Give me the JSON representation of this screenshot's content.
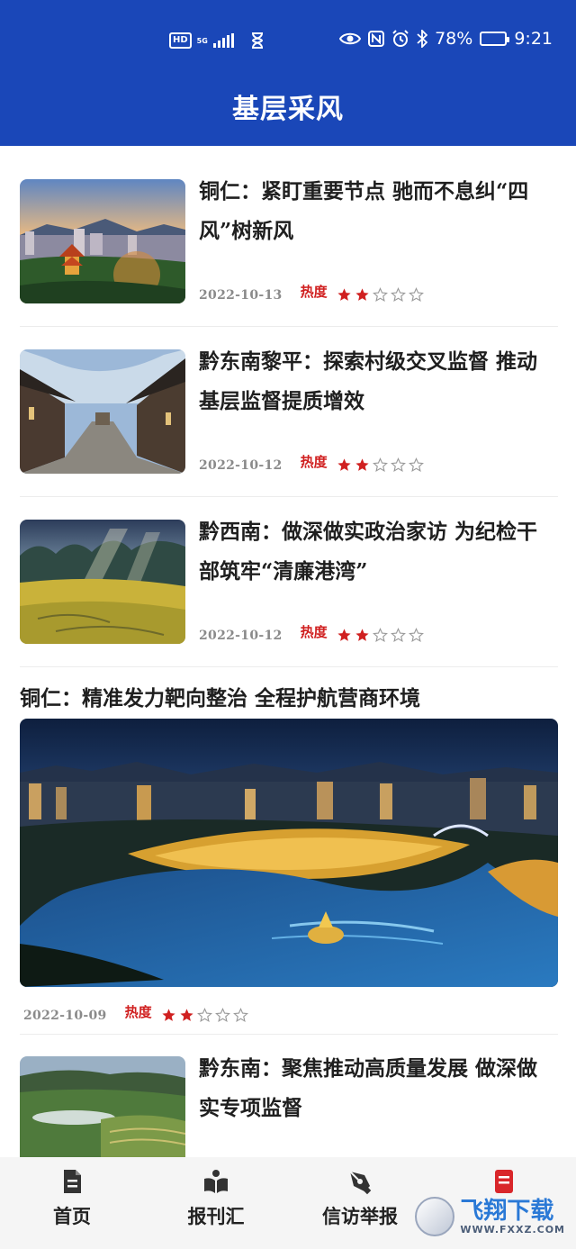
{
  "status_bar": {
    "network_badge": "HD",
    "network_type": "5G",
    "battery_percent": "78%",
    "battery_level": 0.78,
    "time": "9:21"
  },
  "header": {
    "title": "基层采风"
  },
  "heat_label": "热度",
  "articles": [
    {
      "title": "铜仁：紧盯重要节点 驰而不息纠“四风”树新风",
      "date": "2022-10-13",
      "rating": 2,
      "rating_max": 5
    },
    {
      "title": "黔东南黎平：探索村级交叉监督 推动基层监督提质增效",
      "date": "2022-10-12",
      "rating": 2,
      "rating_max": 5
    },
    {
      "title": "黔西南：做深做实政治家访 为纪检干部筑牢“清廉港湾”",
      "date": "2022-10-12",
      "rating": 2,
      "rating_max": 5
    }
  ],
  "featured": {
    "title": "铜仁：精准发力靶向整治 全程护航营商环境",
    "date": "2022-10-09",
    "rating": 2,
    "rating_max": 5
  },
  "last_article": {
    "title": "黔东南：聚焦推动高质量发展 做深做实专项监督"
  },
  "bottom_nav": {
    "items": [
      {
        "label": "首页",
        "icon": "document-icon"
      },
      {
        "label": "报刊汇",
        "icon": "open-book-icon"
      },
      {
        "label": "信访举报",
        "icon": "pen-nib-icon"
      },
      {
        "label": "",
        "icon": "red-book-icon"
      }
    ]
  },
  "watermark": {
    "text": "飞翔下载",
    "sub": "WWW.FXXZ.COM"
  },
  "colors": {
    "primary": "#1a47b8",
    "heat_red": "#d02020",
    "star_outline": "#9a9a9a"
  }
}
